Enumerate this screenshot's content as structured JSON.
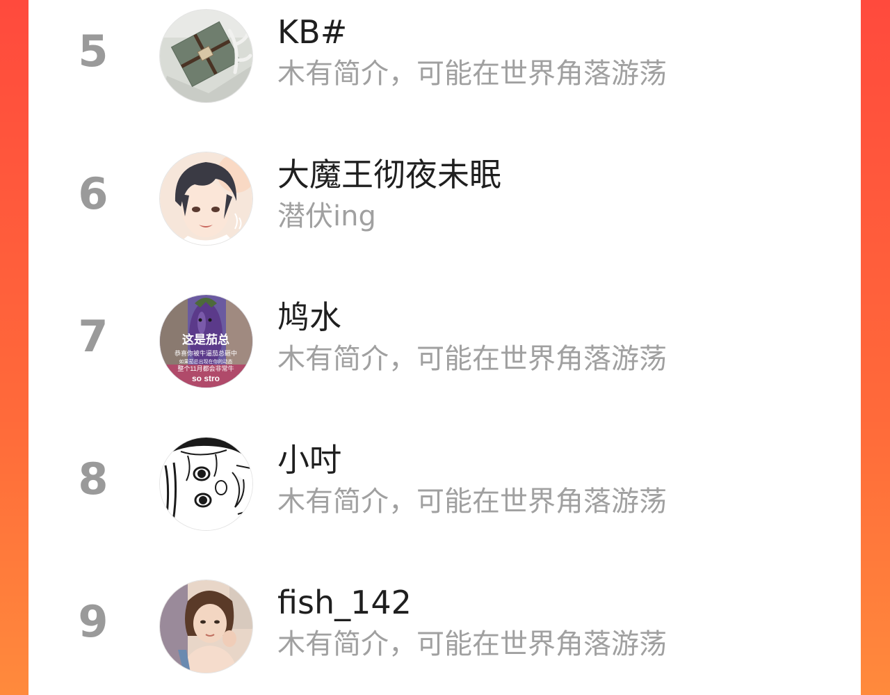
{
  "rank_list": {
    "items": [
      {
        "rank": "5",
        "name": "KB#",
        "bio": "木有简介，可能在世界角落游荡",
        "avatar": "gift-box-photo"
      },
      {
        "rank": "6",
        "name": "大魔王彻夜未眠",
        "bio": "潜伏ing",
        "avatar": "anime-boy-illustration"
      },
      {
        "rank": "7",
        "name": "鸠水",
        "bio": "木有简介，可能在世界角落游荡",
        "avatar": "eggplant-meme",
        "avatar_text": {
          "line1": "这是茄总",
          "line2": "恭喜你被牛逼茄总砸中",
          "line3": "如果茄总出现在你的动态",
          "line4": "整个11月都会非常牛",
          "line5": "so stro"
        }
      },
      {
        "rank": "8",
        "name": "小吋",
        "bio": "木有简介，可能在世界角落游荡",
        "avatar": "manga-girl-sketch"
      },
      {
        "rank": "9",
        "name": "fish_142",
        "bio": "木有简介，可能在世界角落游荡",
        "avatar": "selfie-photo"
      }
    ]
  },
  "colors": {
    "background_gradient_top": "#ff4a3d",
    "background_gradient_bottom": "#ff8a3c",
    "panel": "#ffffff",
    "rank_text": "#9a9a9a",
    "name_text": "#1f1f1f",
    "bio_text": "#a0a0a0"
  }
}
